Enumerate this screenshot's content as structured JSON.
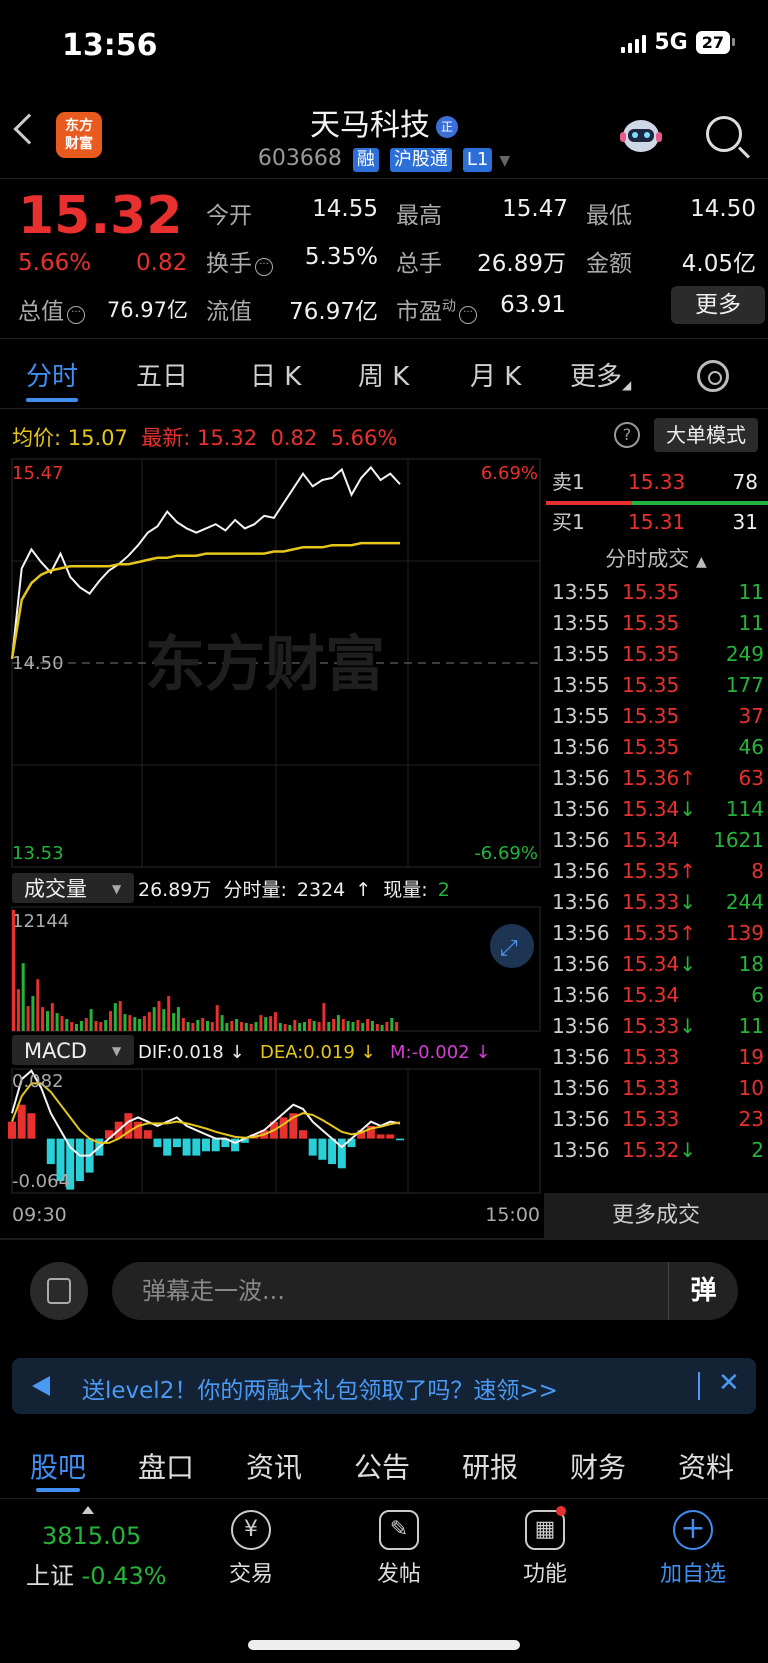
{
  "status": {
    "time": "13:56",
    "network": "5G",
    "battery": "27"
  },
  "header": {
    "logo": [
      "东方",
      "财富"
    ],
    "title": "天马科技",
    "title_badge": "正",
    "code": "603668",
    "tags": [
      "融",
      "沪股通",
      "L1"
    ]
  },
  "quote": {
    "price": "15.32",
    "pct": "5.66%",
    "change": "0.82",
    "cells": [
      {
        "label": "今开",
        "value": "14.55",
        "color": "red"
      },
      {
        "label": "最高",
        "value": "15.47",
        "color": "red"
      },
      {
        "label": "最低",
        "value": "14.50",
        "color": "white"
      },
      {
        "label": "换手",
        "value": "5.35%",
        "color": "white"
      },
      {
        "label": "总手",
        "value": "26.89万",
        "color": "white"
      },
      {
        "label": "金额",
        "value": "4.05亿",
        "color": "white"
      },
      {
        "label": "总值",
        "value": "76.97亿",
        "color": "white"
      },
      {
        "label": "流值",
        "value": "76.97亿",
        "color": "white"
      },
      {
        "label": "市盈",
        "value": "63.91",
        "color": "white"
      }
    ],
    "pe_sup": "动",
    "more_label": "更多"
  },
  "chart_tabs": [
    "分时",
    "五日",
    "日 K",
    "周 K",
    "月 K",
    "更多"
  ],
  "avg_row": {
    "avg_label": "均价:",
    "avg_value": "15.07",
    "latest_label": "最新:",
    "latest_value": "15.32",
    "latest_change": "0.82",
    "latest_pct": "5.66%"
  },
  "help_icon": "?",
  "big_order_label": "大单模式",
  "chart_data": [
    {
      "type": "line",
      "series": [
        {
          "values": [
            14.52,
            14.95,
            15.04,
            14.98,
            14.93,
            15.02,
            14.91,
            14.86,
            14.83,
            14.89,
            14.94,
            14.97,
            15.01,
            15.06,
            15.12,
            15.15,
            15.22,
            15.17,
            15.14,
            15.12,
            15.14,
            15.16,
            15.13,
            15.18,
            15.14,
            15.16,
            15.2,
            15.19,
            15.26,
            15.33,
            15.4,
            15.34,
            15.37,
            15.38,
            15.42,
            15.3,
            15.38,
            15.43,
            15.37,
            15.4,
            15.35
          ]
        },
        {
          "values": [
            14.52,
            14.8,
            14.88,
            14.92,
            14.94,
            14.95,
            14.96,
            14.96,
            14.96,
            14.96,
            14.96,
            14.97,
            14.97,
            14.98,
            14.99,
            15.0,
            15.0,
            15.01,
            15.01,
            15.01,
            15.02,
            15.02,
            15.02,
            15.02,
            15.02,
            15.02,
            15.02,
            15.03,
            15.03,
            15.04,
            15.05,
            15.05,
            15.05,
            15.06,
            15.06,
            15.06,
            15.07,
            15.07,
            15.07,
            15.07,
            15.07
          ]
        }
      ],
      "ylim": [
        13.53,
        15.47
      ],
      "y_tick_labels": [
        "15.47",
        "14.50",
        "13.53"
      ],
      "right_tick_labels": [
        "6.69%",
        "-6.69%"
      ],
      "watermark": "东方财富"
    },
    {
      "type": "bar",
      "title": "成交量",
      "summary": "26.89万",
      "minute_vol_label": "分时量:",
      "minute_vol": "2324",
      "current_label": "现量:",
      "current_vol": "2",
      "y_tick_labels": [
        "12144"
      ],
      "values": [
        12144,
        4200,
        6800,
        2500,
        3500,
        5200,
        2400,
        2000,
        2800,
        1800,
        1500,
        1200,
        900,
        700,
        1000,
        1300,
        2200,
        1000,
        900,
        1100,
        2000,
        2800,
        3000,
        1700,
        1600,
        1400,
        1200,
        1500,
        1900,
        2400,
        3000,
        2200,
        3500,
        1800,
        2400,
        1300,
        900,
        800,
        1100,
        1300,
        1000,
        900,
        2600,
        1600,
        800,
        1000,
        1200,
        900,
        800,
        700,
        900,
        1600,
        1400,
        1500,
        1900,
        800,
        700,
        600,
        1100,
        800,
        900,
        1200,
        1000,
        900,
        2800,
        900,
        1200,
        1600,
        1200,
        1000,
        900,
        1100,
        800,
        1200,
        1000,
        700,
        600,
        900,
        1300,
        900
      ],
      "colors": [
        "r",
        "r",
        "g",
        "r",
        "g",
        "r",
        "r",
        "g",
        "r",
        "g",
        "r",
        "g",
        "r",
        "g",
        "g",
        "r",
        "g",
        "r",
        "r",
        "g",
        "r",
        "g",
        "r",
        "g",
        "r",
        "g",
        "g",
        "r",
        "r",
        "g",
        "r",
        "g",
        "r",
        "g",
        "g",
        "r",
        "g",
        "r",
        "g",
        "r",
        "g",
        "r",
        "r",
        "g",
        "g",
        "r",
        "g",
        "r",
        "g",
        "r",
        "g",
        "r",
        "g",
        "r",
        "r",
        "g",
        "r",
        "g",
        "r",
        "g",
        "g",
        "r",
        "g",
        "r",
        "r",
        "g",
        "r",
        "g",
        "r",
        "g",
        "g",
        "r",
        "g",
        "r",
        "g",
        "r",
        "g",
        "r",
        "g",
        "r"
      ]
    },
    {
      "type": "line",
      "title": "MACD",
      "dif_label": "DIF:0.018 ↓",
      "dea_label": "DEA:0.019 ↓",
      "m_label": "M:-0.002 ↓",
      "y_tick_labels": [
        "0.082",
        "-0.064"
      ],
      "ylim": [
        -0.064,
        0.082
      ],
      "series": [
        {
          "values": [
            0.03,
            0.07,
            0.08,
            0.06,
            0.03,
            0.01,
            -0.01,
            -0.02,
            -0.02,
            -0.01,
            0.0,
            0.01,
            0.02,
            0.025,
            0.02,
            0.015,
            0.02,
            0.025,
            0.015,
            0.01,
            0.005,
            0.0,
            0.0,
            -0.005,
            0.0,
            0.005,
            0.01,
            0.02,
            0.03,
            0.04,
            0.035,
            0.02,
            0.01,
            0.0,
            -0.01,
            0.0,
            0.01,
            0.02,
            0.015,
            0.02,
            0.018
          ]
        },
        {
          "values": [
            0.02,
            0.05,
            0.065,
            0.065,
            0.055,
            0.04,
            0.025,
            0.01,
            0.0,
            -0.005,
            -0.005,
            0.0,
            0.008,
            0.015,
            0.018,
            0.018,
            0.018,
            0.02,
            0.018,
            0.015,
            0.012,
            0.008,
            0.005,
            0.002,
            0.001,
            0.002,
            0.005,
            0.01,
            0.017,
            0.025,
            0.03,
            0.028,
            0.022,
            0.015,
            0.008,
            0.005,
            0.007,
            0.012,
            0.014,
            0.017,
            0.019
          ]
        }
      ],
      "hist": [
        0.02,
        0.04,
        0.03,
        0.0,
        -0.03,
        -0.05,
        -0.06,
        -0.05,
        -0.04,
        -0.02,
        0.01,
        0.02,
        0.03,
        0.02,
        0.01,
        -0.01,
        -0.02,
        -0.01,
        -0.02,
        -0.02,
        -0.015,
        -0.015,
        -0.01,
        -0.015,
        -0.005,
        0.005,
        0.01,
        0.02,
        0.025,
        0.03,
        0.01,
        -0.02,
        -0.025,
        -0.03,
        -0.035,
        -0.01,
        0.01,
        0.015,
        0.005,
        0.005,
        -0.002
      ]
    }
  ],
  "time_axis": [
    "09:30",
    "15:00"
  ],
  "order_book": [
    {
      "label": "卖1",
      "price": "15.33",
      "vol": "78"
    },
    {
      "label": "买1",
      "price": "15.31",
      "vol": "31"
    }
  ],
  "ticks_title": "分时成交",
  "ticks": [
    {
      "time": "13:55",
      "price": "15.35",
      "dir": "",
      "vol": "11",
      "vc": "g"
    },
    {
      "time": "13:55",
      "price": "15.35",
      "dir": "",
      "vol": "11",
      "vc": "g"
    },
    {
      "time": "13:55",
      "price": "15.35",
      "dir": "",
      "vol": "249",
      "vc": "g"
    },
    {
      "time": "13:55",
      "price": "15.35",
      "dir": "",
      "vol": "177",
      "vc": "g"
    },
    {
      "time": "13:55",
      "price": "15.35",
      "dir": "",
      "vol": "37",
      "vc": "r"
    },
    {
      "time": "13:56",
      "price": "15.35",
      "dir": "",
      "vol": "46",
      "vc": "g"
    },
    {
      "time": "13:56",
      "price": "15.36",
      "dir": "↑",
      "vol": "63",
      "vc": "r"
    },
    {
      "time": "13:56",
      "price": "15.34",
      "dir": "↓",
      "vol": "114",
      "vc": "g"
    },
    {
      "time": "13:56",
      "price": "15.34",
      "dir": "",
      "vol": "1621",
      "vc": "g"
    },
    {
      "time": "13:56",
      "price": "15.35",
      "dir": "↑",
      "vol": "8",
      "vc": "r"
    },
    {
      "time": "13:56",
      "price": "15.33",
      "dir": "↓",
      "vol": "244",
      "vc": "g"
    },
    {
      "time": "13:56",
      "price": "15.35",
      "dir": "↑",
      "vol": "139",
      "vc": "r"
    },
    {
      "time": "13:56",
      "price": "15.34",
      "dir": "↓",
      "vol": "18",
      "vc": "g"
    },
    {
      "time": "13:56",
      "price": "15.34",
      "dir": "",
      "vol": "6",
      "vc": "g"
    },
    {
      "time": "13:56",
      "price": "15.33",
      "dir": "↓",
      "vol": "11",
      "vc": "g"
    },
    {
      "time": "13:56",
      "price": "15.33",
      "dir": "",
      "vol": "19",
      "vc": "r"
    },
    {
      "time": "13:56",
      "price": "15.33",
      "dir": "",
      "vol": "10",
      "vc": "r"
    },
    {
      "time": "13:56",
      "price": "15.33",
      "dir": "",
      "vol": "23",
      "vc": "r"
    },
    {
      "time": "13:56",
      "price": "15.32",
      "dir": "↓",
      "vol": "2",
      "vc": "g"
    }
  ],
  "more_ticks_label": "更多成交",
  "danmu": {
    "placeholder": "弹幕走一波...",
    "button": "弹"
  },
  "promo": {
    "text": "送level2！你的两融大礼包领取了吗？速领>>",
    "close": "✕"
  },
  "bottom_tabs": [
    "股吧",
    "盘口",
    "资讯",
    "公告",
    "研报",
    "财务",
    "资料"
  ],
  "index": {
    "value": "3815.05",
    "name": "上证",
    "pct": "-0.43%"
  },
  "nav": [
    {
      "label": "交易",
      "icon": "¥"
    },
    {
      "label": "发帖",
      "icon": "✎"
    },
    {
      "label": "功能",
      "icon": "▦"
    },
    {
      "label": "加自选",
      "icon": "+"
    }
  ],
  "colors": {
    "up": "#e8302f",
    "down": "#26b33a",
    "accent": "#3f8ef0",
    "avg_line": "#e6c619"
  }
}
